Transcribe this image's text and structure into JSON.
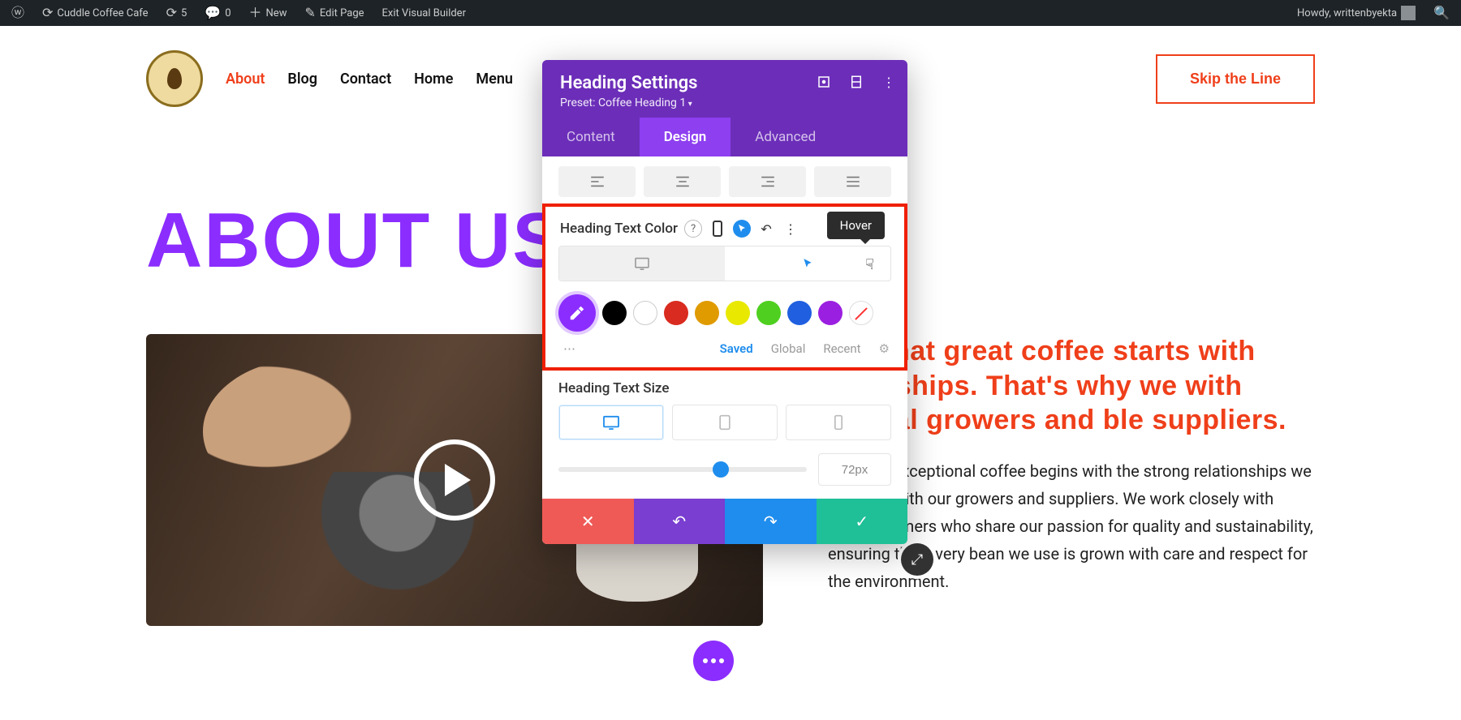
{
  "adminbar": {
    "site_name": "Cuddle Coffee Cafe",
    "updates": "5",
    "comments": "0",
    "new": "New",
    "edit_page": "Edit Page",
    "exit_vb": "Exit Visual Builder",
    "greeting": "Howdy, writtenbyekta"
  },
  "nav": {
    "about": "About",
    "blog": "Blog",
    "contact": "Contact",
    "home": "Home",
    "menu": "Menu",
    "skip": "Skip the Line"
  },
  "hero": {
    "heading": "ABOUT US"
  },
  "body": {
    "pull": "eve that great coffee starts with ationships. That's why we with ethical growers and ble suppliers.",
    "paragraph": "tment to exceptional coffee begins with the strong relationships we cultivate with our growers and suppliers. We work closely with ethical farmers who share our passion for quality and sustainability, ensuring that every bean we use is grown with care and respect for the environment."
  },
  "panel": {
    "title": "Heading Settings",
    "preset": "Preset: Coffee Heading 1",
    "tabs": {
      "content": "Content",
      "design": "Design",
      "advanced": "Advanced"
    },
    "field_color": "Heading Text Color",
    "tooltip_hover": "Hover",
    "swatch_tabs": {
      "saved": "Saved",
      "global": "Global",
      "recent": "Recent"
    },
    "field_size": "Heading Text Size",
    "size_value": "72px",
    "swatches": [
      "#000000",
      "#ffffff",
      "#d92b1f",
      "#e09b00",
      "#e8e800",
      "#4fcf1f",
      "#1f5fe0",
      "#9b1fe0"
    ]
  }
}
